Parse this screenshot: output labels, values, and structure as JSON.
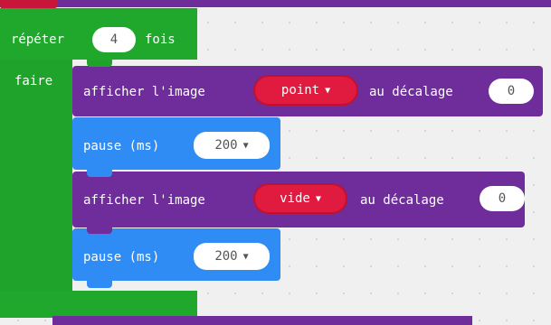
{
  "repeat": {
    "label_repeat": "répéter",
    "times_value": "4",
    "label_times": "fois",
    "label_do": "faire"
  },
  "blocks": [
    {
      "type": "show_image",
      "label_show": "afficher l'image",
      "image_value": "point",
      "label_offset": "au décalage",
      "offset_value": "0"
    },
    {
      "type": "pause",
      "label": "pause (ms)",
      "value": "200"
    },
    {
      "type": "show_image",
      "label_show": "afficher l'image",
      "image_value": "vide",
      "label_offset": "au décalage",
      "offset_value": "0"
    },
    {
      "type": "pause",
      "label": "pause (ms)",
      "value": "200"
    }
  ],
  "colors": {
    "loops": "#20a82d",
    "images": "#6f2d9b",
    "image_dropdown": "#e01b3f",
    "basic": "#2f8cf5",
    "workspace": "#f0f0f0"
  },
  "icons": {
    "dropdown_caret": "caret-down-icon"
  }
}
